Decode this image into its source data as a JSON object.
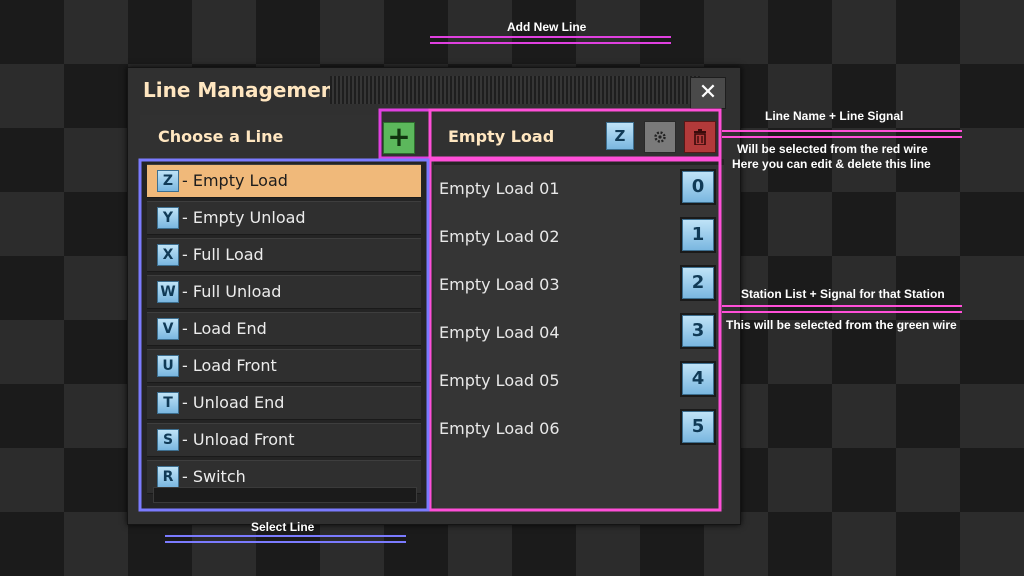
{
  "dialog": {
    "title": "Line Management",
    "close_label": "✕"
  },
  "left_panel": {
    "header": "Choose a Line",
    "add_label": "+",
    "lines": [
      {
        "signal": "Z",
        "label": "- Empty Load",
        "selected": true
      },
      {
        "signal": "Y",
        "label": "- Empty Unload",
        "selected": false
      },
      {
        "signal": "X",
        "label": "- Full Load",
        "selected": false
      },
      {
        "signal": "W",
        "label": "- Full Unload",
        "selected": false
      },
      {
        "signal": "V",
        "label": "- Load End",
        "selected": false
      },
      {
        "signal": "U",
        "label": "- Load Front",
        "selected": false
      },
      {
        "signal": "T",
        "label": "- Unload End",
        "selected": false
      },
      {
        "signal": "S",
        "label": "- Unload Front",
        "selected": false
      },
      {
        "signal": "R",
        "label": "- Switch",
        "selected": false
      }
    ]
  },
  "right_panel": {
    "header": "Empty Load",
    "line_signal": "Z",
    "edit_icon": "gear-icon",
    "delete_icon": "trash-icon",
    "stations": [
      {
        "label": "Empty Load 01",
        "signal": "0"
      },
      {
        "label": "Empty Load 02",
        "signal": "1"
      },
      {
        "label": "Empty Load 03",
        "signal": "2"
      },
      {
        "label": "Empty Load 04",
        "signal": "3"
      },
      {
        "label": "Empty Load 05",
        "signal": "4"
      },
      {
        "label": "Empty Load 06",
        "signal": "5"
      }
    ]
  },
  "annotations": {
    "add_new_line": "Add New Line",
    "line_name_signal": "Line Name + Line Signal",
    "red_wire": "Will be selected from the red wire",
    "edit_delete": "Here you can edit & delete this line",
    "station_list": "Station List + Signal for that Station",
    "green_wire": "This will be selected from the green wire",
    "select_line": "Select Line"
  },
  "colors": {
    "pink": "#ff4fd8",
    "magenta": "#e040e0",
    "blue": "#7b7bff",
    "selected": "#f0b97a",
    "add_button": "#5cb85c",
    "delete_button": "#b23a3a"
  }
}
